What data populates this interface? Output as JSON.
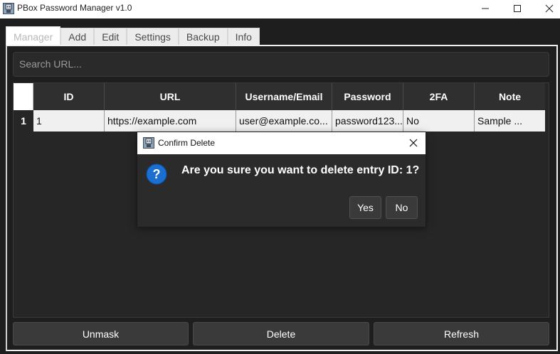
{
  "window": {
    "title": "PBox Password Manager v1.0"
  },
  "tabs": [
    {
      "label": "Manager",
      "active": true
    },
    {
      "label": "Add",
      "active": false
    },
    {
      "label": "Edit",
      "active": false
    },
    {
      "label": "Settings",
      "active": false
    },
    {
      "label": "Backup",
      "active": false
    },
    {
      "label": "Info",
      "active": false
    }
  ],
  "search": {
    "placeholder": "Search URL..."
  },
  "table": {
    "columns": [
      "ID",
      "URL",
      "Username/Email",
      "Password",
      "2FA",
      "Note"
    ],
    "rows": [
      {
        "row_number": "1",
        "cells": [
          "1",
          "https://example.com",
          "user@example.co...",
          "password123...",
          "No",
          "Sample ..."
        ]
      }
    ]
  },
  "buttons": {
    "unmask": "Unmask",
    "delete": "Delete",
    "refresh": "Refresh"
  },
  "dialog": {
    "title": "Confirm Delete",
    "message": "Are you sure you want to delete entry ID: 1?",
    "yes": "Yes",
    "no": "No",
    "icon": "question-icon"
  },
  "colors": {
    "background": "#1e1e1e",
    "question_blue": "#1a6fd1"
  }
}
